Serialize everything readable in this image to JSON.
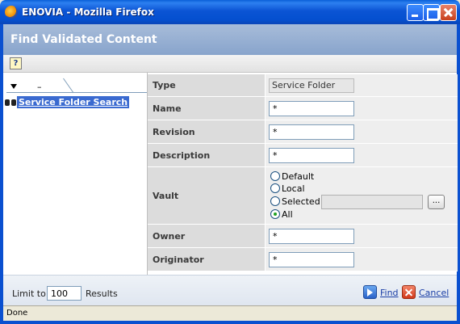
{
  "window": {
    "title": "ENOVIA - Mozilla Firefox",
    "title_bar_color": "#0a50d0"
  },
  "header": {
    "title": "Find Validated Content"
  },
  "toolbar": {
    "help_label": "?"
  },
  "left_pane": {
    "tab_label": "–",
    "search_item": "Service Folder Search"
  },
  "form": {
    "type": {
      "label": "Type",
      "value": "Service Folder"
    },
    "name": {
      "label": "Name",
      "value": "*"
    },
    "revision": {
      "label": "Revision",
      "value": "*"
    },
    "description": {
      "label": "Description",
      "value": "*"
    },
    "vault": {
      "label": "Vault",
      "options": [
        "Default",
        "Local",
        "Selected",
        "All"
      ],
      "selected": "All",
      "selected_value": "",
      "browse_label": "..."
    },
    "owner": {
      "label": "Owner",
      "value": "*"
    },
    "originator": {
      "label": "Originator",
      "value": "*"
    }
  },
  "footer": {
    "limit_label": "Limit to",
    "limit_value": "100",
    "results_label": "Results",
    "find_label": "Find",
    "cancel_label": "Cancel"
  },
  "status": {
    "text": "Done"
  }
}
